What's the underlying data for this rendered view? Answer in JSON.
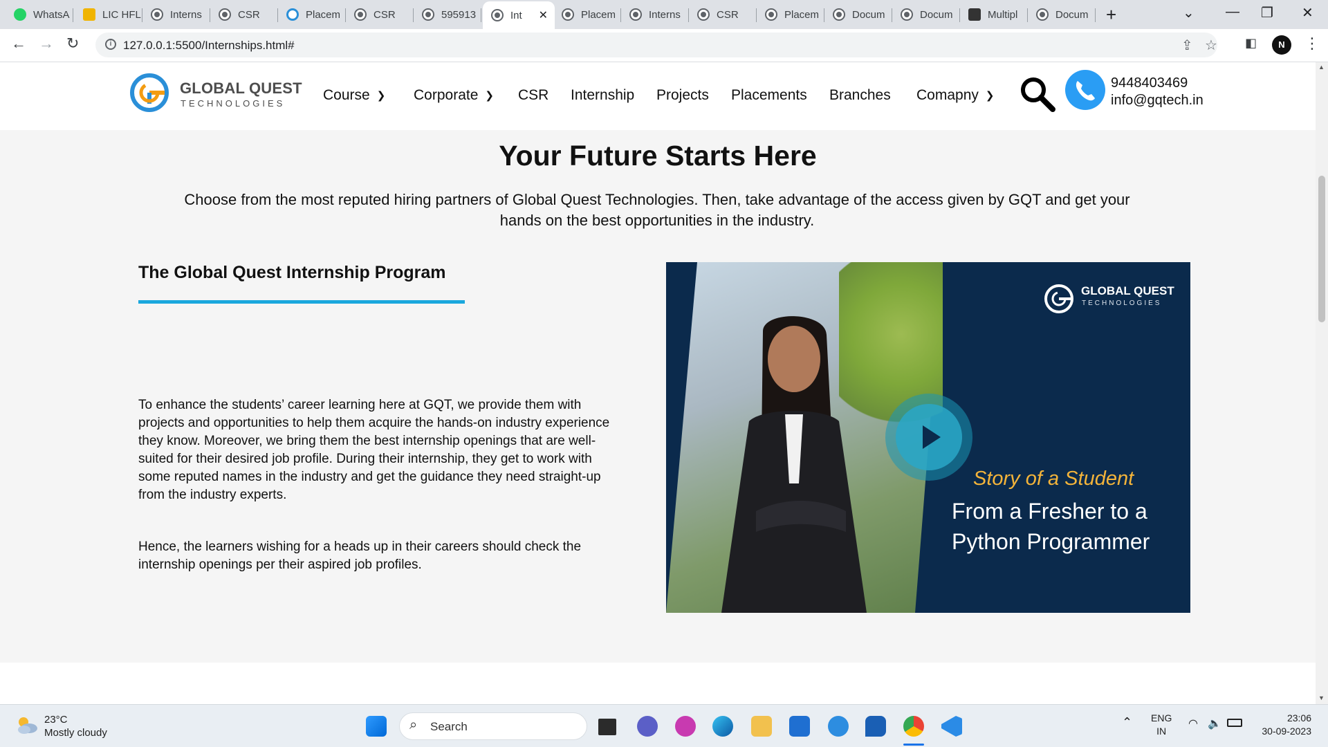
{
  "browser": {
    "tabs": [
      {
        "label": "WhatsA",
        "icon": "whatsapp-icon"
      },
      {
        "label": "LIC HFL",
        "icon": "lic-icon"
      },
      {
        "label": "Interns",
        "icon": "globe-icon"
      },
      {
        "label": "CSR",
        "icon": "globe-icon"
      },
      {
        "label": "Placem",
        "icon": "gq-icon"
      },
      {
        "label": "CSR",
        "icon": "globe-icon"
      },
      {
        "label": "595913",
        "icon": "globe-icon"
      },
      {
        "label": "Int",
        "icon": "globe-icon",
        "active": true
      },
      {
        "label": "Placem",
        "icon": "globe-icon"
      },
      {
        "label": "Interns",
        "icon": "globe-icon"
      },
      {
        "label": "CSR",
        "icon": "globe-icon"
      },
      {
        "label": "Placem",
        "icon": "globe-icon"
      },
      {
        "label": "Docum",
        "icon": "globe-icon"
      },
      {
        "label": "Docum",
        "icon": "globe-icon"
      },
      {
        "label": "Multipl",
        "icon": "app-icon"
      },
      {
        "label": "Docum",
        "icon": "globe-icon"
      }
    ],
    "url": "127.0.0.1:5500/Internships.html#",
    "profile_initial": "N"
  },
  "site": {
    "logo": {
      "line1": "GLOBAL QUEST",
      "line2": "TECHNOLOGIES"
    },
    "nav": [
      {
        "label": "Course",
        "dropdown": true
      },
      {
        "label": "Corporate",
        "dropdown": true
      },
      {
        "label": "CSR",
        "dropdown": false
      },
      {
        "label": "Internship",
        "dropdown": false
      },
      {
        "label": "Projects",
        "dropdown": false
      },
      {
        "label": "Placements",
        "dropdown": false
      },
      {
        "label": "Branches",
        "dropdown": false
      },
      {
        "label": "Comapny",
        "dropdown": true
      }
    ],
    "contact": {
      "phone": "9448403469",
      "email": "info@gqtech.in"
    },
    "hero": {
      "title": "Your Future Starts Here",
      "subtitle": "Choose from the most reputed hiring partners of Global Quest Technologies. Then, take advantage of the access given by GQT and get your hands on the best opportunities in the industry."
    },
    "program": {
      "title": "The Global Quest Internship Program",
      "para1": "To enhance the students’ career learning here at GQT, we provide them with projects and opportunities to help them acquire the hands-on industry experience they know. Moreover, we bring them the best internship openings that are well-suited for their desired job profile. During their internship, they get to work with some reputed names in the industry and get the guidance they need straight-up from the industry experts.",
      "para2": "Hence, the learners wishing for a heads up in their careers should check the internship openings per their aspired job profiles."
    },
    "video": {
      "brand1": "GLOBAL QUEST",
      "brand2": "TECHNOLOGIES",
      "story": "Story of a Student",
      "caption": "From a Fresher to a Python Programmer"
    },
    "accent_color": "#1aa7dd",
    "video_bg_color": "#0b2a4c"
  },
  "taskbar": {
    "weather": {
      "temp": "23°C",
      "desc": "Mostly cloudy"
    },
    "search_label": "Search",
    "lang": {
      "line1": "ENG",
      "line2": "IN"
    },
    "clock": {
      "time": "23:06",
      "date": "30-09-2023"
    }
  }
}
